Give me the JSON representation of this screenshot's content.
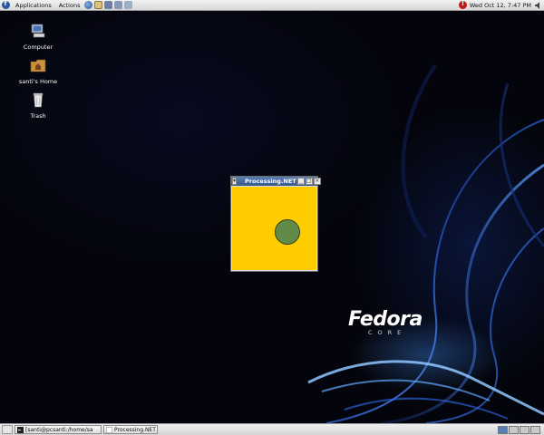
{
  "top_panel": {
    "menus": [
      "Applications",
      "Actions"
    ],
    "launchers": [
      "web-browser-icon",
      "email-icon",
      "text-editor-icon",
      "presentation-icon",
      "office-icon"
    ],
    "clock": "Wed Oct 12,  7:47 PM",
    "icons": [
      "fedora-logo-icon",
      "alert-icon",
      "volume-icon"
    ]
  },
  "desktop": {
    "icons": [
      {
        "label": "Computer",
        "icon": "computer-icon"
      },
      {
        "label": "santi's Home",
        "icon": "home-folder-icon"
      },
      {
        "label": "Trash",
        "icon": "trash-icon"
      }
    ],
    "brand": {
      "word": "Fedora",
      "sub": "CORE"
    }
  },
  "app_window": {
    "title": "Processing.NET",
    "canvas_color": "#ffcc00",
    "circle_color": "#638a47"
  },
  "bottom_panel": {
    "tasks": [
      {
        "label": "[santi@pcsanti:/home/sa",
        "icon": "terminal-icon"
      },
      {
        "label": "Processing.NET",
        "icon": "window-icon"
      }
    ],
    "workspaces": 4,
    "active_workspace": 1
  },
  "colors": {
    "desktop_bg": "#04050c",
    "titlebar": "#35588d"
  }
}
